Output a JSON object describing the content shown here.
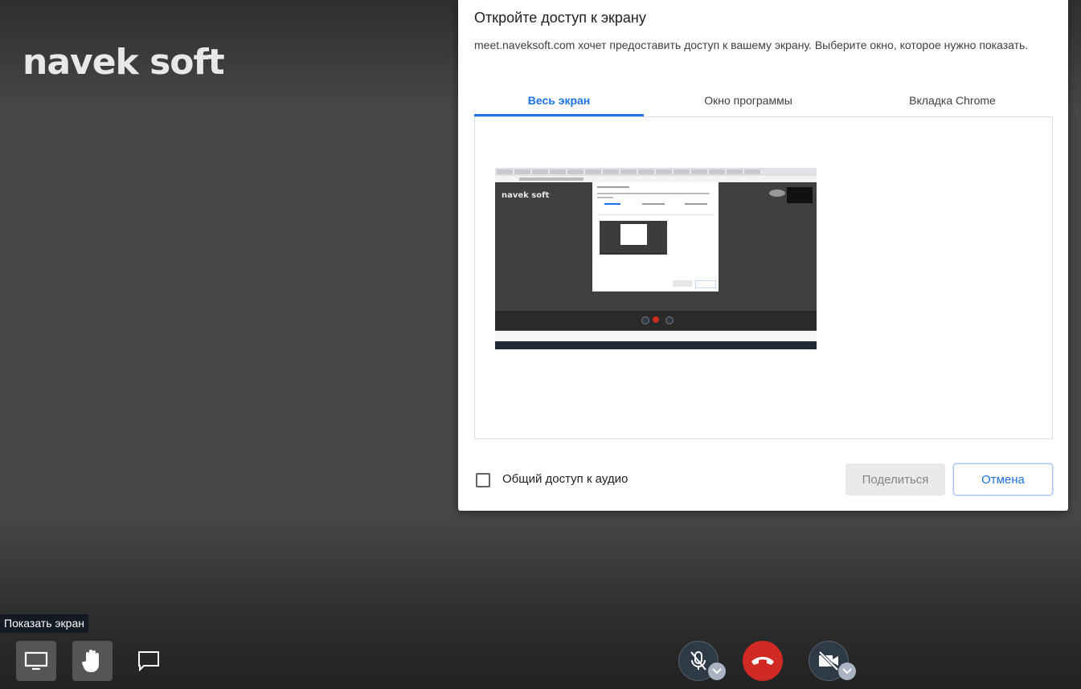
{
  "brand": {
    "logo_text": "navek soft"
  },
  "dialog": {
    "title": "Откройте доступ к экрану",
    "description": "meet.naveksoft.com хочет предоставить доступ к вашему экрану. Выберите окно, которое нужно показать.",
    "tabs": [
      {
        "label": "Весь экран",
        "active": true
      },
      {
        "label": "Окно программы",
        "active": false
      },
      {
        "label": "Вкладка Chrome",
        "active": false
      }
    ],
    "thumbnail": {
      "logo_text": "navek soft"
    },
    "audio_checkbox": {
      "label": "Общий доступ к аудио",
      "checked": false
    },
    "share_button": "Поделиться",
    "cancel_button": "Отмена"
  },
  "tooltip": {
    "text": "Показать экран"
  },
  "toolbar": {
    "left": [
      "screen-share-icon",
      "raise-hand-icon",
      "chat-icon"
    ],
    "center": [
      "mic-off-icon",
      "hangup-icon",
      "camera-off-icon"
    ],
    "colors": {
      "hangup": "#d12a25",
      "dark_button": "#2f3a47",
      "accent": "#1a73e8"
    }
  }
}
